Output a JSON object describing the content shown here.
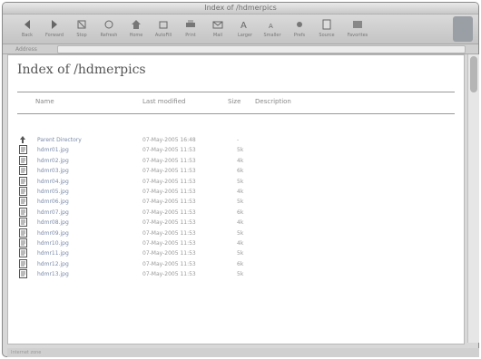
{
  "window": {
    "title": "Index of /hdmerpics"
  },
  "toolbar": {
    "buttons": [
      {
        "label": "Back",
        "icon": "back-icon"
      },
      {
        "label": "Forward",
        "icon": "forward-icon"
      },
      {
        "label": "Stop",
        "icon": "stop-icon"
      },
      {
        "label": "Refresh",
        "icon": "refresh-icon"
      },
      {
        "label": "Home",
        "icon": "home-icon"
      },
      {
        "label": "AutoFill",
        "icon": "autofill-icon"
      },
      {
        "label": "Print",
        "icon": "print-icon"
      },
      {
        "label": "Mail",
        "icon": "mail-icon"
      },
      {
        "label": "Larger",
        "icon": "larger-text-icon"
      },
      {
        "label": "Smaller",
        "icon": "smaller-text-icon"
      },
      {
        "label": "Prefs",
        "icon": "preferences-icon"
      },
      {
        "label": "Source",
        "icon": "source-icon"
      },
      {
        "label": "Favorites",
        "icon": "favorites-icon"
      }
    ]
  },
  "addressbar": {
    "label": "Address",
    "url": ""
  },
  "page": {
    "title": "Index of /hdmerpics",
    "columns": {
      "name": "Name",
      "modified": "Last modified",
      "size": "Size",
      "description": "Description"
    },
    "rows": [
      {
        "name": "Parent Directory",
        "date": "07-May-2005 16:48",
        "size": "-",
        "icon": "folder-up-icon"
      },
      {
        "name": "hdmr01.jpg",
        "date": "07-May-2005 11:53",
        "size": "5k",
        "icon": "image-file-icon"
      },
      {
        "name": "hdmr02.jpg",
        "date": "07-May-2005 11:53",
        "size": "4k",
        "icon": "image-file-icon"
      },
      {
        "name": "hdmr03.jpg",
        "date": "07-May-2005 11:53",
        "size": "6k",
        "icon": "image-file-icon"
      },
      {
        "name": "hdmr04.jpg",
        "date": "07-May-2005 11:53",
        "size": "5k",
        "icon": "image-file-icon"
      },
      {
        "name": "hdmr05.jpg",
        "date": "07-May-2005 11:53",
        "size": "4k",
        "icon": "image-file-icon"
      },
      {
        "name": "hdmr06.jpg",
        "date": "07-May-2005 11:53",
        "size": "5k",
        "icon": "image-file-icon"
      },
      {
        "name": "hdmr07.jpg",
        "date": "07-May-2005 11:53",
        "size": "6k",
        "icon": "image-file-icon"
      },
      {
        "name": "hdmr08.jpg",
        "date": "07-May-2005 11:53",
        "size": "4k",
        "icon": "image-file-icon"
      },
      {
        "name": "hdmr09.jpg",
        "date": "07-May-2005 11:53",
        "size": "5k",
        "icon": "image-file-icon"
      },
      {
        "name": "hdmr10.jpg",
        "date": "07-May-2005 11:53",
        "size": "4k",
        "icon": "image-file-icon"
      },
      {
        "name": "hdmr11.jpg",
        "date": "07-May-2005 11:53",
        "size": "5k",
        "icon": "image-file-icon"
      },
      {
        "name": "hdmr12.jpg",
        "date": "07-May-2005 11:53",
        "size": "6k",
        "icon": "image-file-icon"
      },
      {
        "name": "hdmr13.jpg",
        "date": "07-May-2005 11:53",
        "size": "5k",
        "icon": "image-file-icon"
      }
    ]
  },
  "status": {
    "text": "Internet zone"
  }
}
